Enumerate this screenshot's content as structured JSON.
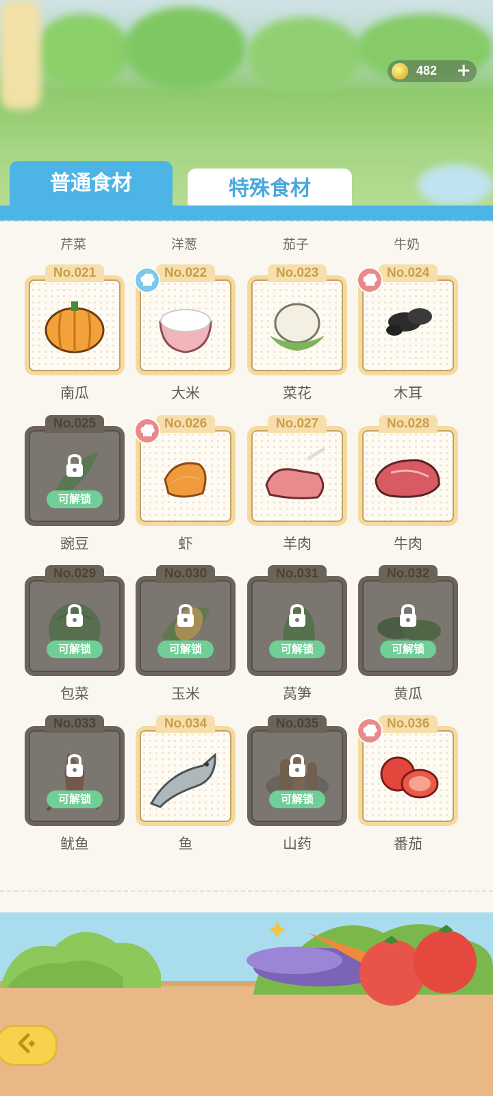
{
  "currency": {
    "icon": "coin-icon",
    "value": "482",
    "add_icon": "plus-icon"
  },
  "tabs": [
    {
      "label": "普通食材",
      "active": true
    },
    {
      "label": "特殊食材",
      "active": false
    }
  ],
  "top_row_labels": [
    "芹菜",
    "洋葱",
    "茄子",
    "牛奶"
  ],
  "unlock_label": "可解锁",
  "items": [
    {
      "no": "No.021",
      "name": "南瓜",
      "locked": false,
      "badge": null
    },
    {
      "no": "No.022",
      "name": "大米",
      "locked": false,
      "badge": "blue-chef-badge"
    },
    {
      "no": "No.023",
      "name": "菜花",
      "locked": false,
      "badge": null
    },
    {
      "no": "No.024",
      "name": "木耳",
      "locked": false,
      "badge": "red-chef-badge"
    },
    {
      "no": "No.025",
      "name": "豌豆",
      "locked": true,
      "badge": null
    },
    {
      "no": "No.026",
      "name": "虾",
      "locked": false,
      "badge": "red-chef-badge"
    },
    {
      "no": "No.027",
      "name": "羊肉",
      "locked": false,
      "badge": null
    },
    {
      "no": "No.028",
      "name": "牛肉",
      "locked": false,
      "badge": null
    },
    {
      "no": "No.029",
      "name": "包菜",
      "locked": true,
      "badge": null
    },
    {
      "no": "No.030",
      "name": "玉米",
      "locked": true,
      "badge": null
    },
    {
      "no": "No.031",
      "name": "莴笋",
      "locked": true,
      "badge": null
    },
    {
      "no": "No.032",
      "name": "黄瓜",
      "locked": true,
      "badge": null
    },
    {
      "no": "No.033",
      "name": "鱿鱼",
      "locked": true,
      "badge": null
    },
    {
      "no": "No.034",
      "name": "鱼",
      "locked": false,
      "badge": null
    },
    {
      "no": "No.035",
      "name": "山药",
      "locked": true,
      "badge": null
    },
    {
      "no": "No.036",
      "name": "番茄",
      "locked": false,
      "badge": "red-chef-badge"
    }
  ],
  "colors": {
    "accent": "#4db5e6",
    "unlock": "#6fcf97",
    "card_border": "#f6d99c"
  },
  "back_button": {
    "icon": "back-arrow-icon"
  }
}
